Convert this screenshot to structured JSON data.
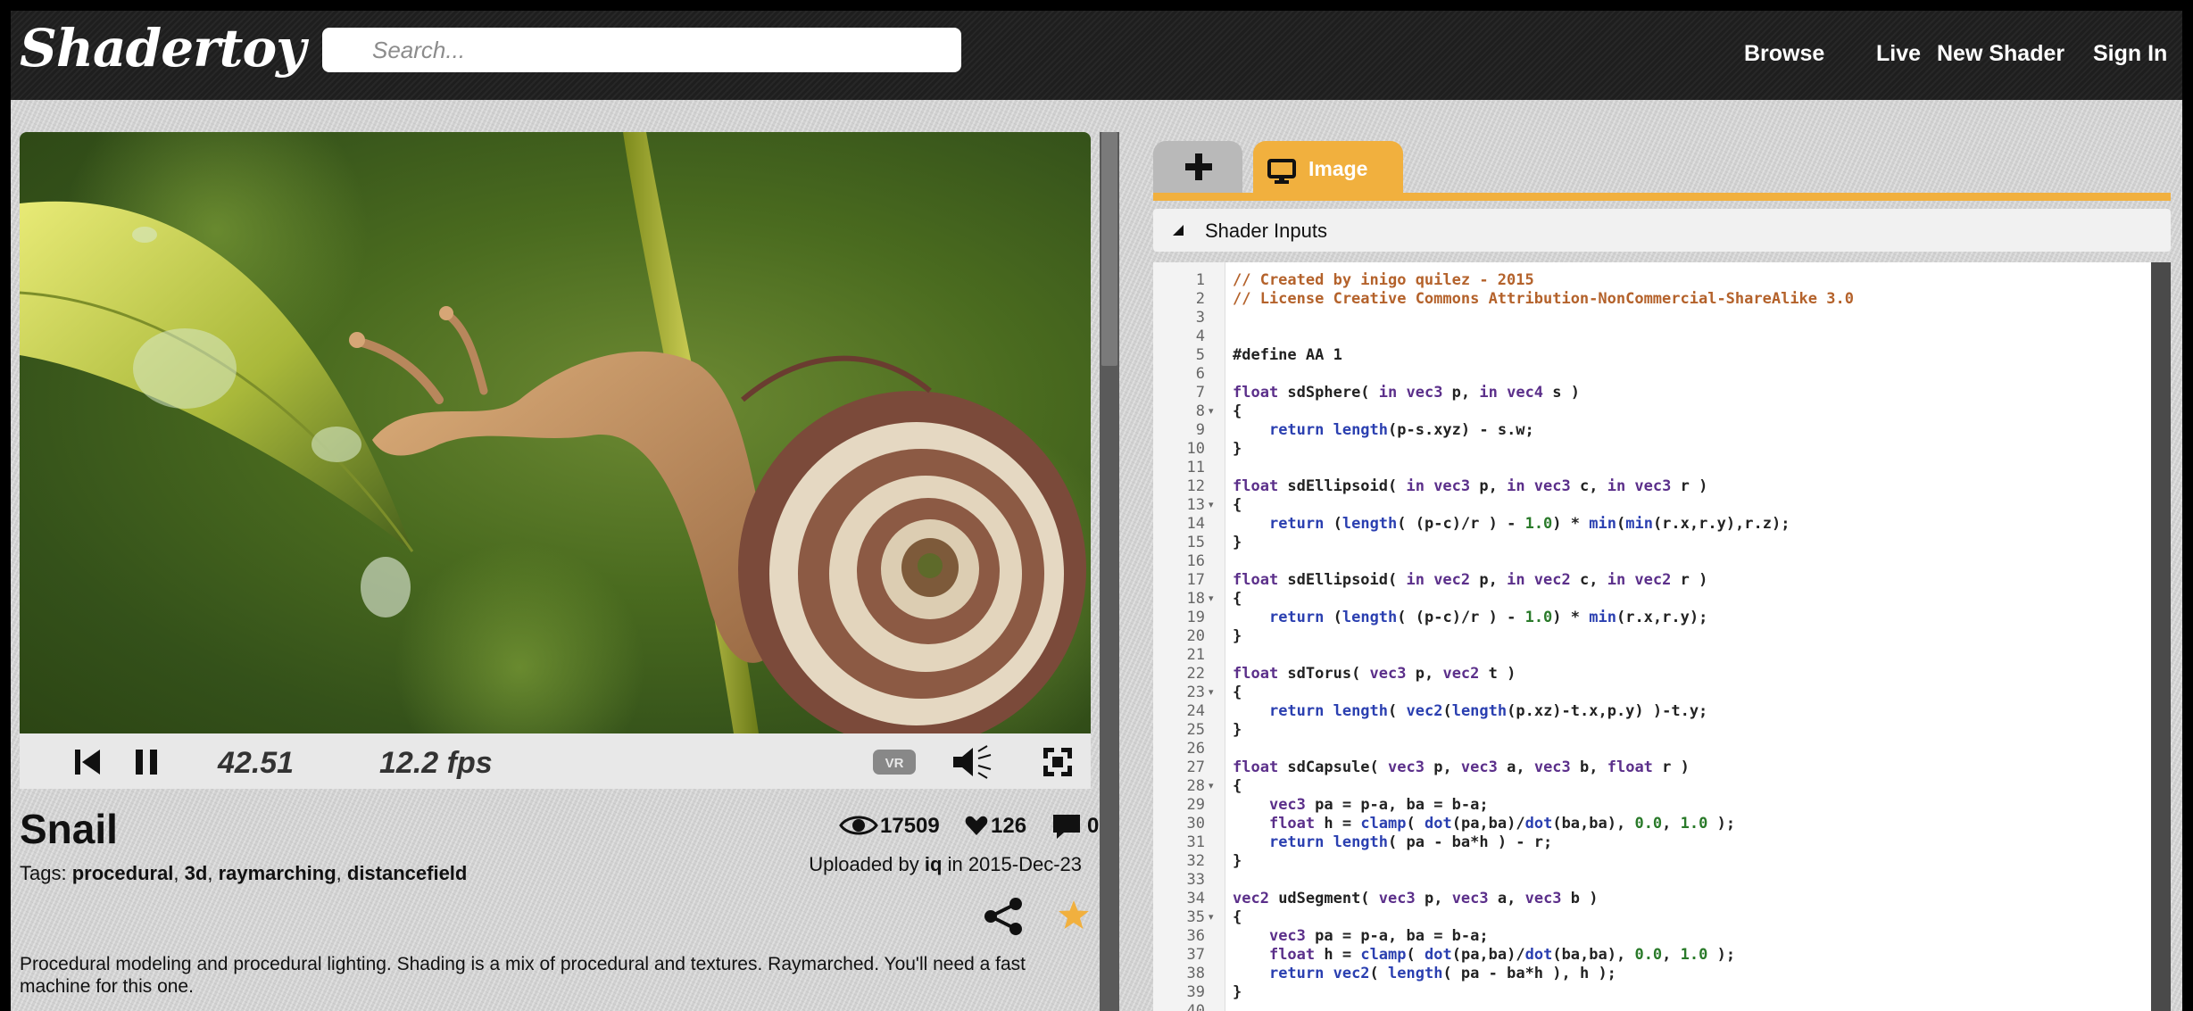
{
  "header": {
    "logo": "Shadertoy",
    "search_placeholder": "Search...",
    "nav": [
      "Browse",
      "Live",
      "New Shader",
      "Sign In"
    ]
  },
  "player": {
    "time": "42.51",
    "fps": "12.2 fps",
    "vr_label": "VR"
  },
  "shader": {
    "title": "Snail",
    "tags_label": "Tags:",
    "tags": [
      "procedural",
      "3d",
      "raymarching",
      "distancefield"
    ],
    "views": "17509",
    "likes": "126",
    "comments": "0",
    "uploaded_prefix": "Uploaded by",
    "author": "iq",
    "date_prefix": "in",
    "date": "2015-Dec-23",
    "description": "Procedural modeling and procedural lighting. Shading is a mix of procedural and textures. Raymarched. You'll need a fast machine for this one."
  },
  "editor": {
    "tab_image_label": "Image",
    "shader_inputs_label": "Shader Inputs",
    "lines": [
      [
        [
          "cm",
          "// Created by inigo quilez - 2015"
        ]
      ],
      [
        [
          "cm",
          "// License Creative Commons Attribution-NonCommercial-ShareAlike 3.0"
        ]
      ],
      [],
      [],
      [
        [
          "tx",
          "#define AA 1"
        ]
      ],
      [],
      [
        [
          "kw",
          "float"
        ],
        [
          "tx",
          " sdSphere( "
        ],
        [
          "kw",
          "in vec3"
        ],
        [
          "tx",
          " p, "
        ],
        [
          "kw",
          "in vec4"
        ],
        [
          "tx",
          " s )"
        ]
      ],
      [
        [
          "tx",
          "{"
        ]
      ],
      [
        [
          "tx",
          "    "
        ],
        [
          "fn",
          "return length"
        ],
        [
          "tx",
          "(p-s.xyz) - s.w;"
        ]
      ],
      [
        [
          "tx",
          "}"
        ]
      ],
      [],
      [
        [
          "kw",
          "float"
        ],
        [
          "tx",
          " sdEllipsoid( "
        ],
        [
          "kw",
          "in vec3"
        ],
        [
          "tx",
          " p, "
        ],
        [
          "kw",
          "in vec3"
        ],
        [
          "tx",
          " c, "
        ],
        [
          "kw",
          "in vec3"
        ],
        [
          "tx",
          " r )"
        ]
      ],
      [
        [
          "tx",
          "{"
        ]
      ],
      [
        [
          "tx",
          "    "
        ],
        [
          "fn",
          "return"
        ],
        [
          "tx",
          " ("
        ],
        [
          "fn",
          "length"
        ],
        [
          "tx",
          "( (p-c)/r ) - "
        ],
        [
          "nm",
          "1.0"
        ],
        [
          "tx",
          ") * "
        ],
        [
          "fn",
          "min"
        ],
        [
          "tx",
          "("
        ],
        [
          "fn",
          "min"
        ],
        [
          "tx",
          "(r.x,r.y),r.z);"
        ]
      ],
      [
        [
          "tx",
          "}"
        ]
      ],
      [],
      [
        [
          "kw",
          "float"
        ],
        [
          "tx",
          " sdEllipsoid( "
        ],
        [
          "kw",
          "in vec2"
        ],
        [
          "tx",
          " p, "
        ],
        [
          "kw",
          "in vec2"
        ],
        [
          "tx",
          " c, "
        ],
        [
          "kw",
          "in vec2"
        ],
        [
          "tx",
          " r )"
        ]
      ],
      [
        [
          "tx",
          "{"
        ]
      ],
      [
        [
          "tx",
          "    "
        ],
        [
          "fn",
          "return"
        ],
        [
          "tx",
          " ("
        ],
        [
          "fn",
          "length"
        ],
        [
          "tx",
          "( (p-c)/r ) - "
        ],
        [
          "nm",
          "1.0"
        ],
        [
          "tx",
          ") * "
        ],
        [
          "fn",
          "min"
        ],
        [
          "tx",
          "(r.x,r.y);"
        ]
      ],
      [
        [
          "tx",
          "}"
        ]
      ],
      [],
      [
        [
          "kw",
          "float"
        ],
        [
          "tx",
          " sdTorus( "
        ],
        [
          "kw",
          "vec3"
        ],
        [
          "tx",
          " p, "
        ],
        [
          "kw",
          "vec2"
        ],
        [
          "tx",
          " t )"
        ]
      ],
      [
        [
          "tx",
          "{"
        ]
      ],
      [
        [
          "tx",
          "    "
        ],
        [
          "fn",
          "return length"
        ],
        [
          "tx",
          "( "
        ],
        [
          "fn",
          "vec2"
        ],
        [
          "tx",
          "("
        ],
        [
          "fn",
          "length"
        ],
        [
          "tx",
          "(p.xz)-t.x,p.y) )-t.y;"
        ]
      ],
      [
        [
          "tx",
          "}"
        ]
      ],
      [],
      [
        [
          "kw",
          "float"
        ],
        [
          "tx",
          " sdCapsule( "
        ],
        [
          "kw",
          "vec3"
        ],
        [
          "tx",
          " p, "
        ],
        [
          "kw",
          "vec3"
        ],
        [
          "tx",
          " a, "
        ],
        [
          "kw",
          "vec3"
        ],
        [
          "tx",
          " b, "
        ],
        [
          "kw",
          "float"
        ],
        [
          "tx",
          " r )"
        ]
      ],
      [
        [
          "tx",
          "{"
        ]
      ],
      [
        [
          "tx",
          "    "
        ],
        [
          "kw",
          "vec3"
        ],
        [
          "tx",
          " pa = p-a, ba = b-a;"
        ]
      ],
      [
        [
          "tx",
          "    "
        ],
        [
          "kw",
          "float"
        ],
        [
          "tx",
          " h = "
        ],
        [
          "fn",
          "clamp"
        ],
        [
          "tx",
          "( "
        ],
        [
          "fn",
          "dot"
        ],
        [
          "tx",
          "(pa,ba)/"
        ],
        [
          "fn",
          "dot"
        ],
        [
          "tx",
          "(ba,ba), "
        ],
        [
          "nm",
          "0.0"
        ],
        [
          "tx",
          ", "
        ],
        [
          "nm",
          "1.0"
        ],
        [
          "tx",
          " );"
        ]
      ],
      [
        [
          "tx",
          "    "
        ],
        [
          "fn",
          "return length"
        ],
        [
          "tx",
          "( pa - ba*h ) - r;"
        ]
      ],
      [
        [
          "tx",
          "}"
        ]
      ],
      [],
      [
        [
          "kw",
          "vec2"
        ],
        [
          "tx",
          " udSegment( "
        ],
        [
          "kw",
          "vec3"
        ],
        [
          "tx",
          " p, "
        ],
        [
          "kw",
          "vec3"
        ],
        [
          "tx",
          " a, "
        ],
        [
          "kw",
          "vec3"
        ],
        [
          "tx",
          " b )"
        ]
      ],
      [
        [
          "tx",
          "{"
        ]
      ],
      [
        [
          "tx",
          "    "
        ],
        [
          "kw",
          "vec3"
        ],
        [
          "tx",
          " pa = p-a, ba = b-a;"
        ]
      ],
      [
        [
          "tx",
          "    "
        ],
        [
          "kw",
          "float"
        ],
        [
          "tx",
          " h = "
        ],
        [
          "fn",
          "clamp"
        ],
        [
          "tx",
          "( "
        ],
        [
          "fn",
          "dot"
        ],
        [
          "tx",
          "(pa,ba)/"
        ],
        [
          "fn",
          "dot"
        ],
        [
          "tx",
          "(ba,ba), "
        ],
        [
          "nm",
          "0.0"
        ],
        [
          "tx",
          ", "
        ],
        [
          "nm",
          "1.0"
        ],
        [
          "tx",
          " );"
        ]
      ],
      [
        [
          "tx",
          "    "
        ],
        [
          "fn",
          "return vec2"
        ],
        [
          "tx",
          "( "
        ],
        [
          "fn",
          "length"
        ],
        [
          "tx",
          "( pa - ba*h ), h );"
        ]
      ],
      [
        [
          "tx",
          "}"
        ]
      ],
      []
    ],
    "fold_lines": [
      8,
      13,
      18,
      23,
      28,
      35
    ]
  },
  "colors": {
    "accent": "#f1b03e",
    "header_bg": "#202020",
    "comment": "#b4622b",
    "keyword": "#5b2f8a",
    "function": "#2a3fb0",
    "number": "#2a7a2a"
  },
  "icons": [
    "skip-back-icon",
    "pause-icon",
    "vr-icon",
    "volume-icon",
    "fullscreen-icon",
    "eye-icon",
    "heart-icon",
    "comment-icon",
    "share-icon",
    "star-icon",
    "plus-icon",
    "monitor-icon",
    "triangle-down-icon"
  ]
}
